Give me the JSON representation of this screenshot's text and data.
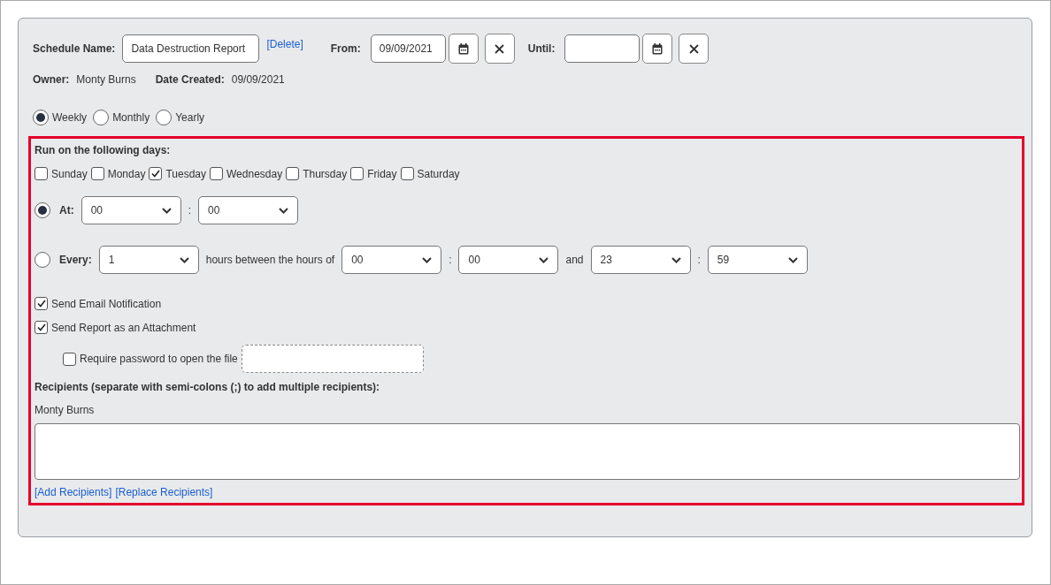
{
  "schedule_name": {
    "label": "Schedule Name:",
    "value": "Data Destruction Report"
  },
  "delete_link": "[Delete]",
  "from": {
    "label": "From:",
    "value": "09/09/2021"
  },
  "until": {
    "label": "Until:"
  },
  "owner": {
    "label": "Owner:",
    "value": "Monty Burns"
  },
  "date_created": {
    "label": "Date Created:",
    "value": "09/09/2021"
  },
  "frequency": [
    {
      "label": "Weekly",
      "selected": true
    },
    {
      "label": "Monthly",
      "selected": false
    },
    {
      "label": "Yearly",
      "selected": false
    }
  ],
  "days_title": "Run on the following days:",
  "days": [
    {
      "label": "Sunday",
      "checked": false
    },
    {
      "label": "Monday",
      "checked": false
    },
    {
      "label": "Tuesday",
      "checked": true
    },
    {
      "label": "Wednesday",
      "checked": false
    },
    {
      "label": "Thursday",
      "checked": false
    },
    {
      "label": "Friday",
      "checked": false
    },
    {
      "label": "Saturday",
      "checked": false
    }
  ],
  "at": {
    "selected": true,
    "label": "At:",
    "hour": "00",
    "separator": ":",
    "minute": "00"
  },
  "every": {
    "selected": false,
    "label": "Every:",
    "interval": "1",
    "text": "hours between the hours of",
    "start_hour": "00",
    "start_separator": ":",
    "start_minute": "00",
    "and": "and",
    "end_hour": "23",
    "end_separator": ":",
    "end_minute": "59"
  },
  "options": [
    {
      "kind": "check",
      "label": "Send Email Notification",
      "checked": true
    },
    {
      "kind": "check",
      "label": "Send Report as an Attachment",
      "checked": true
    },
    {
      "kind": "check_with_field",
      "label": "Require password to open the file",
      "checked": false
    }
  ],
  "recipients": {
    "title": "Recipients (separate with semi-colons (;) to add multiple recipients):",
    "current": "Monty Burns",
    "links": [
      "[Add Recipients]",
      "[Replace Recipients]"
    ]
  }
}
